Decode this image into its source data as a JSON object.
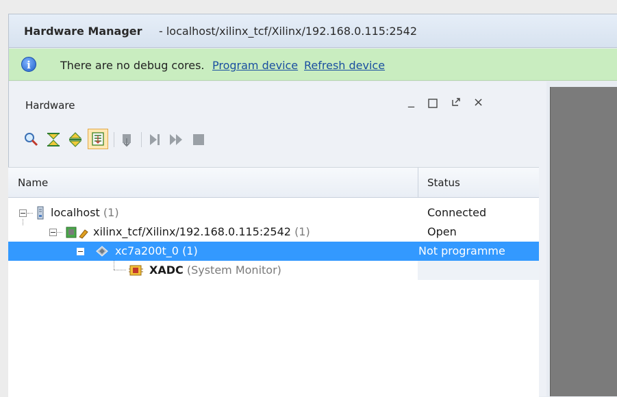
{
  "window": {
    "title": "Hardware Manager",
    "subtitle": "- localhost/xilinx_tcf/Xilinx/192.168.0.115:2542"
  },
  "info_bar": {
    "icon": "info-icon",
    "message": "There are no debug cores.",
    "link_program": "Program device",
    "link_refresh": "Refresh device",
    "color": "#c9edc0"
  },
  "panel": {
    "title": "Hardware",
    "controls": [
      "minimize-icon",
      "maximize-icon",
      "restore-icon",
      "close-icon"
    ]
  },
  "toolbar": {
    "icons": [
      "search-icon",
      "collapse-all-icon",
      "expand-all-icon",
      "auto-connect-icon",
      "program-device-icon",
      "run-trigger-icon",
      "run-trigger-immediate-icon",
      "stop-trigger-icon"
    ]
  },
  "table": {
    "columns": [
      "Name",
      "Status"
    ],
    "rows": [
      {
        "name": "localhost",
        "count": "(1)",
        "status": "Connected"
      },
      {
        "name": "xilinx_tcf/Xilinx/192.168.0.115:2542",
        "count": "(1)",
        "status": "Open"
      },
      {
        "name": "xc7a200t_0",
        "count": "(1)",
        "status": "Not programme",
        "selected": true
      },
      {
        "name": "XADC",
        "count": "(System Monitor)",
        "status": ""
      }
    ]
  },
  "colors": {
    "selection": "#3399ff",
    "link": "#1a4fa0"
  }
}
